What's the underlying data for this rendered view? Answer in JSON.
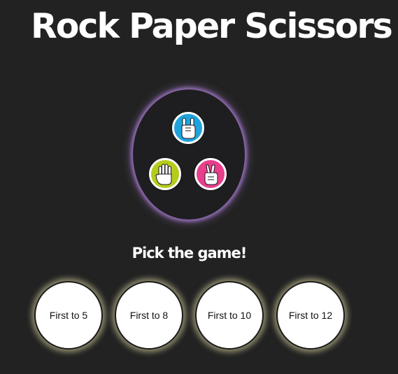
{
  "header": {
    "title": "Rock Paper Scissors"
  },
  "logo": {
    "hands": [
      {
        "name": "rock",
        "icon": "rock-hand-icon",
        "color": "#1fa3dc"
      },
      {
        "name": "paper",
        "icon": "paper-hand-icon",
        "color": "#b5cc1a"
      },
      {
        "name": "scissors",
        "icon": "scissors-hand-icon",
        "color": "#e83e8c"
      }
    ],
    "glow_color": "#8f6bb0"
  },
  "prompt": {
    "text": "Pick the game!"
  },
  "options": [
    {
      "label": "First to 5"
    },
    {
      "label": "First to 8"
    },
    {
      "label": "First to 10"
    },
    {
      "label": "First to 12"
    }
  ],
  "colors": {
    "background": "#222222",
    "option_fill": "#ffffff",
    "option_glow": "#e8e2aa"
  }
}
